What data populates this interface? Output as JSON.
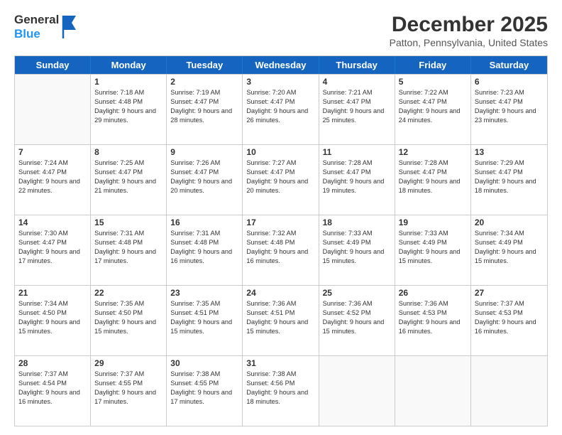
{
  "logo": {
    "line1": "General",
    "line2": "Blue"
  },
  "title": "December 2025",
  "subtitle": "Patton, Pennsylvania, United States",
  "days_of_week": [
    "Sunday",
    "Monday",
    "Tuesday",
    "Wednesday",
    "Thursday",
    "Friday",
    "Saturday"
  ],
  "weeks": [
    [
      {
        "num": "",
        "empty": true,
        "sunrise": "",
        "sunset": "",
        "daylight": ""
      },
      {
        "num": "1",
        "empty": false,
        "sunrise": "Sunrise: 7:18 AM",
        "sunset": "Sunset: 4:48 PM",
        "daylight": "Daylight: 9 hours and 29 minutes."
      },
      {
        "num": "2",
        "empty": false,
        "sunrise": "Sunrise: 7:19 AM",
        "sunset": "Sunset: 4:47 PM",
        "daylight": "Daylight: 9 hours and 28 minutes."
      },
      {
        "num": "3",
        "empty": false,
        "sunrise": "Sunrise: 7:20 AM",
        "sunset": "Sunset: 4:47 PM",
        "daylight": "Daylight: 9 hours and 26 minutes."
      },
      {
        "num": "4",
        "empty": false,
        "sunrise": "Sunrise: 7:21 AM",
        "sunset": "Sunset: 4:47 PM",
        "daylight": "Daylight: 9 hours and 25 minutes."
      },
      {
        "num": "5",
        "empty": false,
        "sunrise": "Sunrise: 7:22 AM",
        "sunset": "Sunset: 4:47 PM",
        "daylight": "Daylight: 9 hours and 24 minutes."
      },
      {
        "num": "6",
        "empty": false,
        "sunrise": "Sunrise: 7:23 AM",
        "sunset": "Sunset: 4:47 PM",
        "daylight": "Daylight: 9 hours and 23 minutes."
      }
    ],
    [
      {
        "num": "7",
        "empty": false,
        "sunrise": "Sunrise: 7:24 AM",
        "sunset": "Sunset: 4:47 PM",
        "daylight": "Daylight: 9 hours and 22 minutes."
      },
      {
        "num": "8",
        "empty": false,
        "sunrise": "Sunrise: 7:25 AM",
        "sunset": "Sunset: 4:47 PM",
        "daylight": "Daylight: 9 hours and 21 minutes."
      },
      {
        "num": "9",
        "empty": false,
        "sunrise": "Sunrise: 7:26 AM",
        "sunset": "Sunset: 4:47 PM",
        "daylight": "Daylight: 9 hours and 20 minutes."
      },
      {
        "num": "10",
        "empty": false,
        "sunrise": "Sunrise: 7:27 AM",
        "sunset": "Sunset: 4:47 PM",
        "daylight": "Daylight: 9 hours and 20 minutes."
      },
      {
        "num": "11",
        "empty": false,
        "sunrise": "Sunrise: 7:28 AM",
        "sunset": "Sunset: 4:47 PM",
        "daylight": "Daylight: 9 hours and 19 minutes."
      },
      {
        "num": "12",
        "empty": false,
        "sunrise": "Sunrise: 7:28 AM",
        "sunset": "Sunset: 4:47 PM",
        "daylight": "Daylight: 9 hours and 18 minutes."
      },
      {
        "num": "13",
        "empty": false,
        "sunrise": "Sunrise: 7:29 AM",
        "sunset": "Sunset: 4:47 PM",
        "daylight": "Daylight: 9 hours and 18 minutes."
      }
    ],
    [
      {
        "num": "14",
        "empty": false,
        "sunrise": "Sunrise: 7:30 AM",
        "sunset": "Sunset: 4:47 PM",
        "daylight": "Daylight: 9 hours and 17 minutes."
      },
      {
        "num": "15",
        "empty": false,
        "sunrise": "Sunrise: 7:31 AM",
        "sunset": "Sunset: 4:48 PM",
        "daylight": "Daylight: 9 hours and 17 minutes."
      },
      {
        "num": "16",
        "empty": false,
        "sunrise": "Sunrise: 7:31 AM",
        "sunset": "Sunset: 4:48 PM",
        "daylight": "Daylight: 9 hours and 16 minutes."
      },
      {
        "num": "17",
        "empty": false,
        "sunrise": "Sunrise: 7:32 AM",
        "sunset": "Sunset: 4:48 PM",
        "daylight": "Daylight: 9 hours and 16 minutes."
      },
      {
        "num": "18",
        "empty": false,
        "sunrise": "Sunrise: 7:33 AM",
        "sunset": "Sunset: 4:49 PM",
        "daylight": "Daylight: 9 hours and 15 minutes."
      },
      {
        "num": "19",
        "empty": false,
        "sunrise": "Sunrise: 7:33 AM",
        "sunset": "Sunset: 4:49 PM",
        "daylight": "Daylight: 9 hours and 15 minutes."
      },
      {
        "num": "20",
        "empty": false,
        "sunrise": "Sunrise: 7:34 AM",
        "sunset": "Sunset: 4:49 PM",
        "daylight": "Daylight: 9 hours and 15 minutes."
      }
    ],
    [
      {
        "num": "21",
        "empty": false,
        "sunrise": "Sunrise: 7:34 AM",
        "sunset": "Sunset: 4:50 PM",
        "daylight": "Daylight: 9 hours and 15 minutes."
      },
      {
        "num": "22",
        "empty": false,
        "sunrise": "Sunrise: 7:35 AM",
        "sunset": "Sunset: 4:50 PM",
        "daylight": "Daylight: 9 hours and 15 minutes."
      },
      {
        "num": "23",
        "empty": false,
        "sunrise": "Sunrise: 7:35 AM",
        "sunset": "Sunset: 4:51 PM",
        "daylight": "Daylight: 9 hours and 15 minutes."
      },
      {
        "num": "24",
        "empty": false,
        "sunrise": "Sunrise: 7:36 AM",
        "sunset": "Sunset: 4:51 PM",
        "daylight": "Daylight: 9 hours and 15 minutes."
      },
      {
        "num": "25",
        "empty": false,
        "sunrise": "Sunrise: 7:36 AM",
        "sunset": "Sunset: 4:52 PM",
        "daylight": "Daylight: 9 hours and 15 minutes."
      },
      {
        "num": "26",
        "empty": false,
        "sunrise": "Sunrise: 7:36 AM",
        "sunset": "Sunset: 4:53 PM",
        "daylight": "Daylight: 9 hours and 16 minutes."
      },
      {
        "num": "27",
        "empty": false,
        "sunrise": "Sunrise: 7:37 AM",
        "sunset": "Sunset: 4:53 PM",
        "daylight": "Daylight: 9 hours and 16 minutes."
      }
    ],
    [
      {
        "num": "28",
        "empty": false,
        "sunrise": "Sunrise: 7:37 AM",
        "sunset": "Sunset: 4:54 PM",
        "daylight": "Daylight: 9 hours and 16 minutes."
      },
      {
        "num": "29",
        "empty": false,
        "sunrise": "Sunrise: 7:37 AM",
        "sunset": "Sunset: 4:55 PM",
        "daylight": "Daylight: 9 hours and 17 minutes."
      },
      {
        "num": "30",
        "empty": false,
        "sunrise": "Sunrise: 7:38 AM",
        "sunset": "Sunset: 4:55 PM",
        "daylight": "Daylight: 9 hours and 17 minutes."
      },
      {
        "num": "31",
        "empty": false,
        "sunrise": "Sunrise: 7:38 AM",
        "sunset": "Sunset: 4:56 PM",
        "daylight": "Daylight: 9 hours and 18 minutes."
      },
      {
        "num": "",
        "empty": true,
        "sunrise": "",
        "sunset": "",
        "daylight": ""
      },
      {
        "num": "",
        "empty": true,
        "sunrise": "",
        "sunset": "",
        "daylight": ""
      },
      {
        "num": "",
        "empty": true,
        "sunrise": "",
        "sunset": "",
        "daylight": ""
      }
    ]
  ]
}
